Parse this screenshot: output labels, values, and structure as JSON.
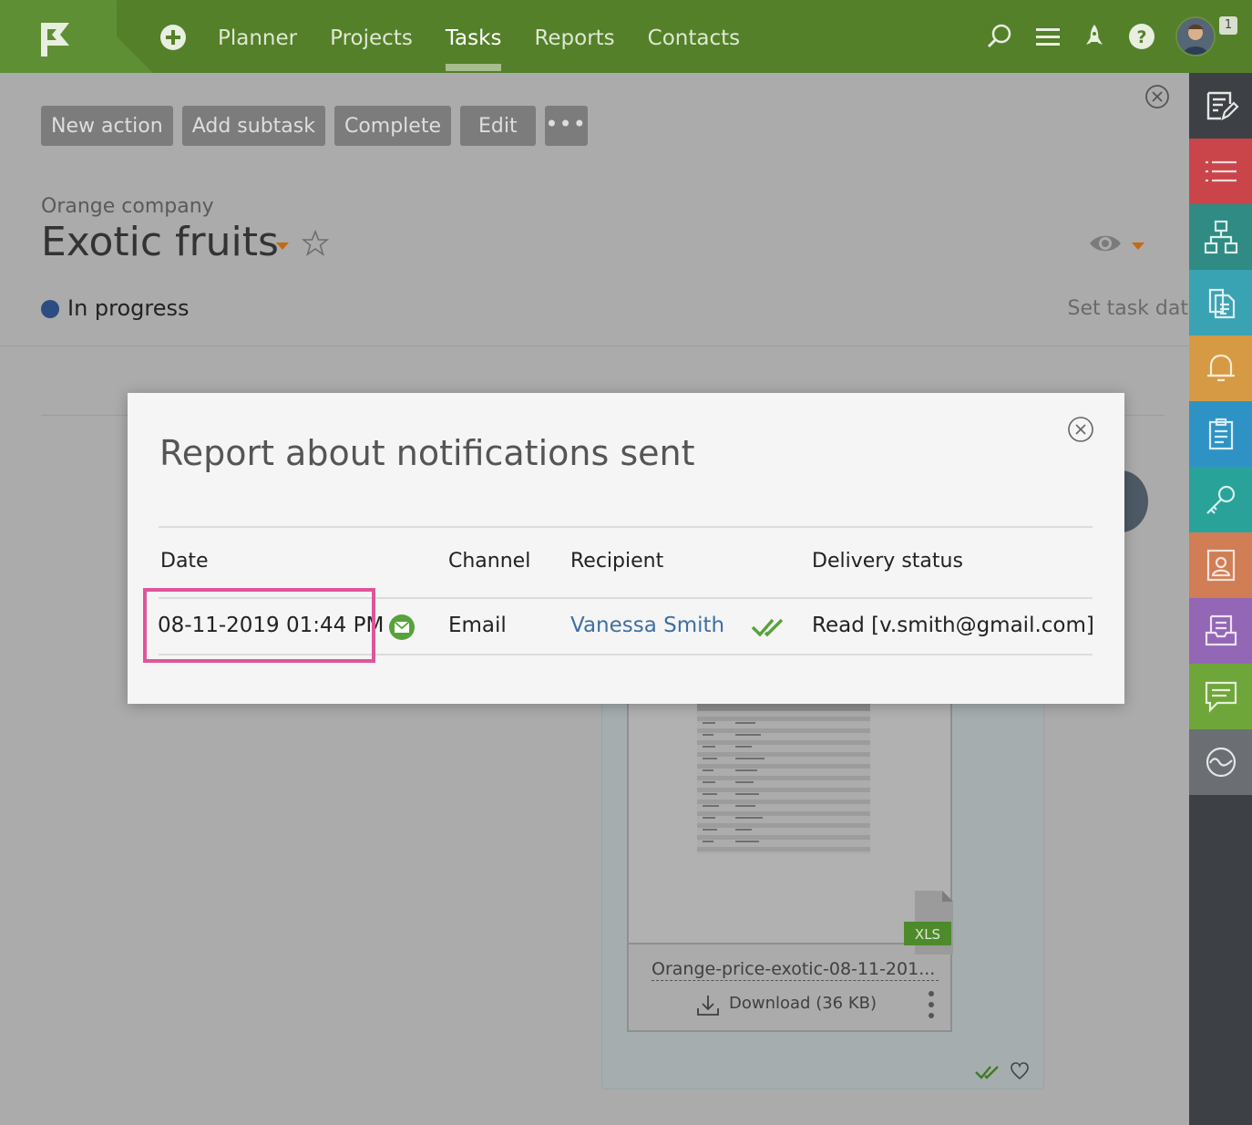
{
  "topbar": {
    "nav": [
      {
        "label": "Planner",
        "active": false
      },
      {
        "label": "Projects",
        "active": false
      },
      {
        "label": "Tasks",
        "active": true
      },
      {
        "label": "Reports",
        "active": false
      },
      {
        "label": "Contacts",
        "active": false
      }
    ],
    "icons": [
      "add-icon",
      "search-icon",
      "menu-icon",
      "rocket-icon",
      "help-icon"
    ],
    "notification_count": "1",
    "brand_color": "#548029"
  },
  "actions": {
    "new_action": "New action",
    "add_subtask": "Add subtask",
    "complete": "Complete",
    "edit": "Edit",
    "more": "•••"
  },
  "task": {
    "company": "Orange company",
    "title": "Exotic fruits",
    "status": "In progress",
    "status_color": "#2a4d82",
    "set_dates": "Set task dates"
  },
  "file": {
    "name": "Orange-price-exotic-08-11-201...",
    "type_badge": "XLS",
    "download_label": "Download (36 KB)"
  },
  "sidebar": {
    "items": [
      {
        "icon": "notes-edit-icon",
        "color": "#3d4044"
      },
      {
        "icon": "list-icon",
        "color": "#c9454a"
      },
      {
        "icon": "hierarchy-icon",
        "color": "#2f8b83"
      },
      {
        "icon": "documents-icon",
        "color": "#3aa3b3"
      },
      {
        "icon": "bell-icon",
        "color": "#d69a45"
      },
      {
        "icon": "clipboard-icon",
        "color": "#2e93c4"
      },
      {
        "icon": "key-icon",
        "color": "#29a39a"
      },
      {
        "icon": "contact-card-icon",
        "color": "#d17d55"
      },
      {
        "icon": "inbox-icon",
        "color": "#9366b6"
      },
      {
        "icon": "chat-icon",
        "color": "#6fa63a"
      },
      {
        "icon": "activity-icon",
        "color": "#6b6e72"
      }
    ]
  },
  "modal": {
    "title": "Report about notifications sent",
    "columns": {
      "date": "Date",
      "channel": "Channel",
      "recipient": "Recipient",
      "delivery_status": "Delivery status"
    },
    "rows": [
      {
        "date": "08-11-2019 01:44 PM",
        "channel": "Email",
        "recipient": "Vanessa Smith",
        "delivery_status": "Read [v.smith@gmail.com]"
      }
    ],
    "highlight_color": "#e0559a"
  }
}
